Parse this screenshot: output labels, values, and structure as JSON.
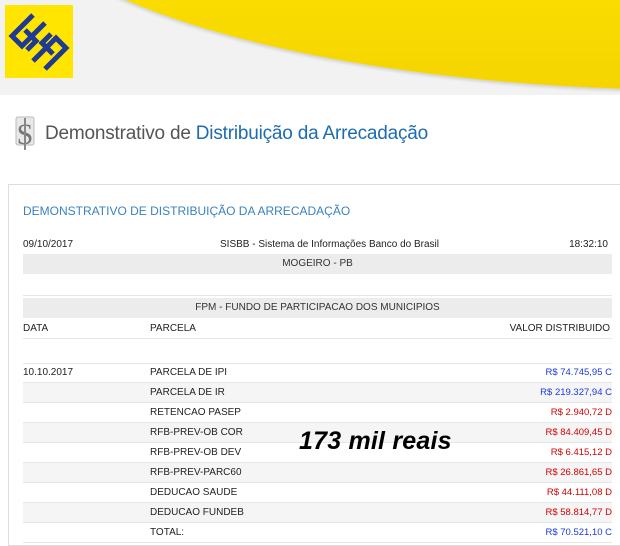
{
  "brand": {
    "accent": "#ffe500",
    "logo_icon": "banco-do-brasil-logo"
  },
  "page": {
    "icon": "dollar-document-icon",
    "title_prefix": "Demonstrativo de ",
    "title_highlight": "Distribuição da Arrecadação"
  },
  "report": {
    "heading": "DEMONSTRATIVO DE DISTRIBUIÇÃO DA ARRECADAÇÃO",
    "date": "09/10/2017",
    "system": "SISBB - Sistema de Informações Banco do Brasil",
    "time": "18:32:10",
    "municipio": "MOGEIRO - PB",
    "fund": "FPM - FUNDO DE PARTICIPACAO DOS MUNICIPIOS",
    "columns": {
      "date": "DATA",
      "parcela": "PARCELA",
      "valor": "VALOR DISTRIBUIDO"
    },
    "rows": [
      {
        "date": "10.10.2017",
        "parcela": "PARCELA DE IPI",
        "valor": "R$ 74.745,95 C",
        "type": "C"
      },
      {
        "date": "",
        "parcela": "PARCELA DE IR",
        "valor": "R$ 219.327,94 C",
        "type": "C"
      },
      {
        "date": "",
        "parcela": "RETENCAO PASEP",
        "valor": "R$ 2.940,72 D",
        "type": "D"
      },
      {
        "date": "",
        "parcela": "RFB-PREV-OB COR",
        "valor": "R$ 84.409,45 D",
        "type": "D"
      },
      {
        "date": "",
        "parcela": "RFB-PREV-OB DEV",
        "valor": "R$ 6.415,12 D",
        "type": "D"
      },
      {
        "date": "",
        "parcela": "RFB-PREV-PARC60",
        "valor": "R$ 26.861,65 D",
        "type": "D"
      },
      {
        "date": "",
        "parcela": "DEDUCAO SAUDE",
        "valor": "R$ 44.111,08 D",
        "type": "D"
      },
      {
        "date": "",
        "parcela": "DEDUCAO FUNDEB",
        "valor": "R$ 58.814,77 D",
        "type": "D"
      },
      {
        "date": "",
        "parcela": "TOTAL:",
        "valor": "R$ 70.521,10 C",
        "type": "C"
      }
    ]
  },
  "overlay_text": "173 mil reais"
}
